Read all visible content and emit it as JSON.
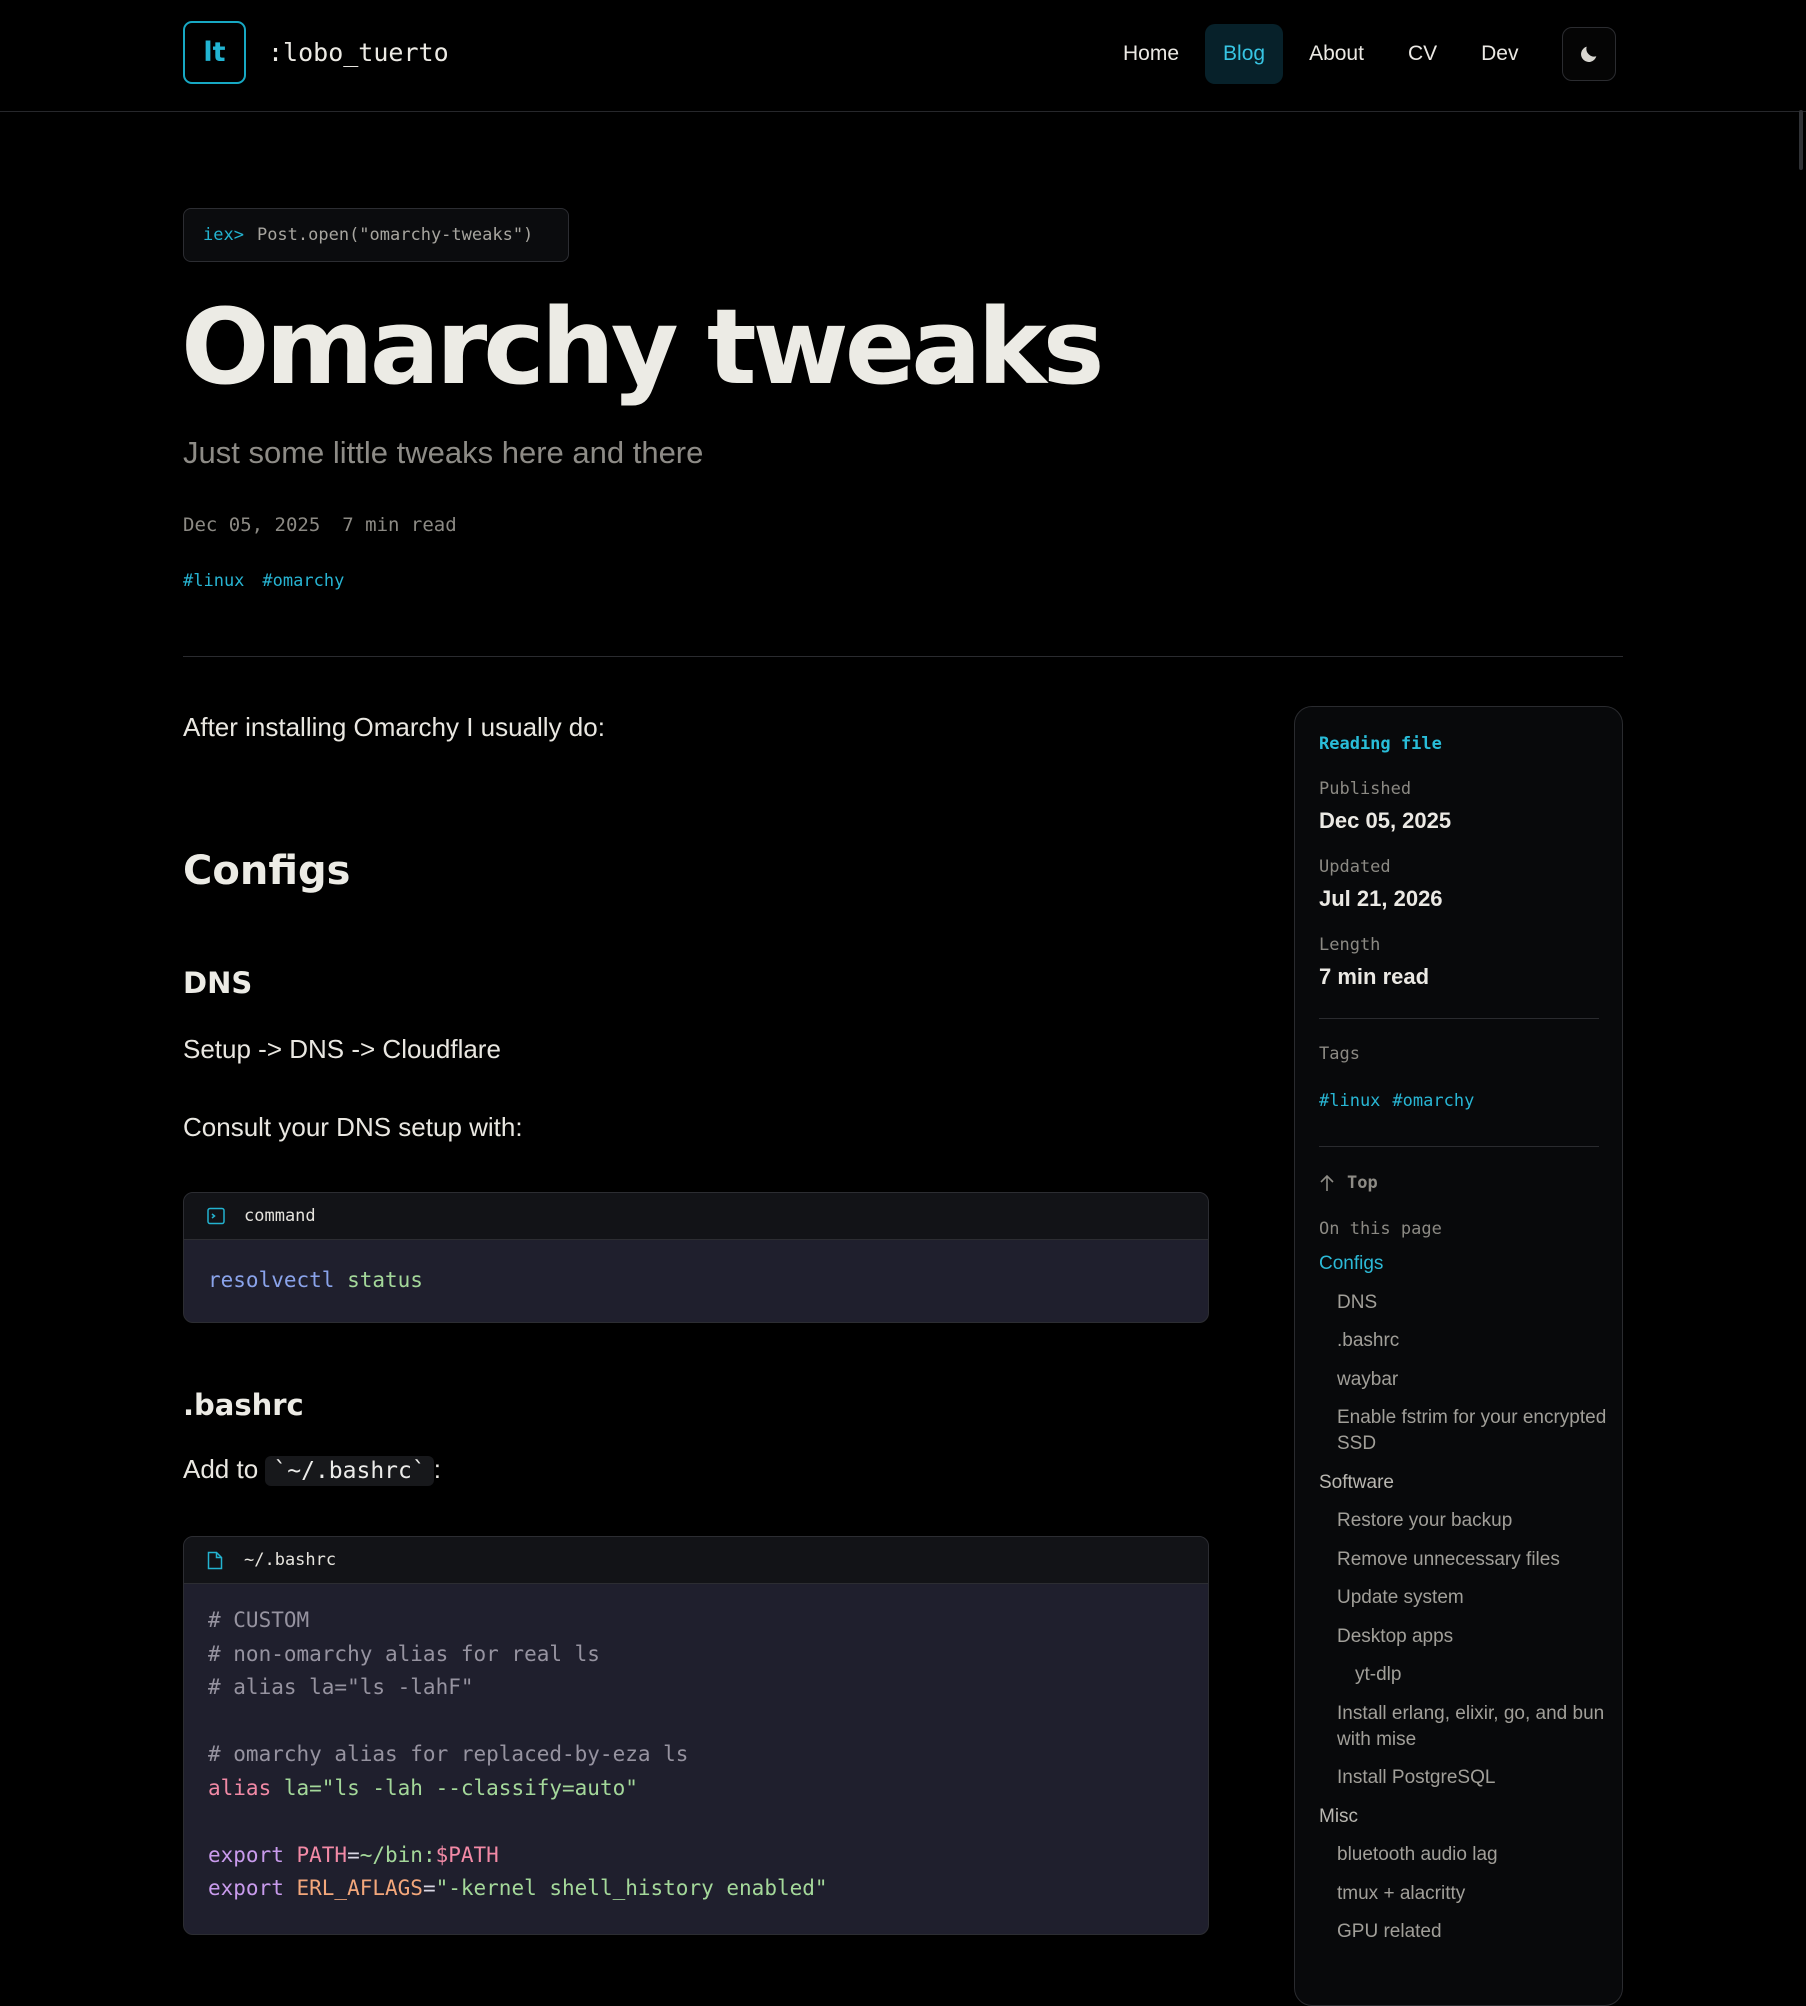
{
  "header": {
    "logo_text": "lt",
    "brand": ":lobo_tuerto",
    "nav": [
      {
        "label": "Home",
        "active": false
      },
      {
        "label": "Blog",
        "active": true
      },
      {
        "label": "About",
        "active": false
      },
      {
        "label": "CV",
        "active": false
      },
      {
        "label": "Dev",
        "active": false
      }
    ],
    "theme_icon": "moon-icon"
  },
  "hero": {
    "prompt_prefix": "iex>",
    "prompt_cmd": "Post.open(\"omarchy-tweaks\")",
    "title": "Omarchy tweaks",
    "subtitle": "Just some little tweaks here and there",
    "date": "Dec 05, 2025",
    "read_time": "7 min read",
    "tags": [
      "#linux",
      "#omarchy"
    ]
  },
  "article": {
    "intro": "After installing Omarchy I usually do:",
    "h2_configs": "Configs",
    "h3_dns": "DNS",
    "dns_setup": "Setup -> DNS -> Cloudflare",
    "dns_consult": "Consult your DNS setup with:",
    "block1": {
      "label": "command",
      "icon": "terminal-icon",
      "cmd_fn": "resolvectl",
      "cmd_arg": " status"
    },
    "h3_bashrc": ".bashrc",
    "bashrc_prefix": "Add to",
    "bashrc_code": "`~/.bashrc`",
    "bashrc_suffix": ":",
    "block2": {
      "label": "~/.bashrc",
      "icon": "file-icon",
      "l1": "# CUSTOM",
      "l2": "# non-omarchy alias for real ls",
      "l3": "# alias la=\"ls -lahF\"",
      "l5": "# omarchy alias for replaced-by-eza ls",
      "l6_kw": "alias",
      "l6_rest": " la=",
      "l6_str": "\"ls -lah --classify=auto\"",
      "l8_kw": "export",
      "l8_var": " PATH",
      "l8_eq": "=",
      "l8_val": "~/bin:",
      "l8_var2": "$PATH",
      "l9_kw": "export",
      "l9_var": " ERL_AFLAGS",
      "l9_eq": "=",
      "l9_str": "\"-kernel shell_history enabled\""
    }
  },
  "sidebar": {
    "heading": "Reading file",
    "published_label": "Published",
    "published": "Dec 05, 2025",
    "updated_label": "Updated",
    "updated": "Jul 21, 2026",
    "length_label": "Length",
    "length": "7 min read",
    "tags_label": "Tags",
    "tags": [
      "#linux",
      "#omarchy"
    ],
    "top_label": "Top",
    "toc_label": "On this page",
    "toc": [
      {
        "label": "Configs",
        "level": 1,
        "active": true
      },
      {
        "label": "DNS",
        "level": 2
      },
      {
        "label": ".bashrc",
        "level": 2
      },
      {
        "label": "waybar",
        "level": 2
      },
      {
        "label": "Enable fstrim for your encrypted SSD",
        "level": 2
      },
      {
        "label": "Software",
        "level": 1
      },
      {
        "label": "Restore your backup",
        "level": 2
      },
      {
        "label": "Remove unnecessary files",
        "level": 2
      },
      {
        "label": "Update system",
        "level": 2
      },
      {
        "label": "Desktop apps",
        "level": 2
      },
      {
        "label": "yt-dlp",
        "level": 3
      },
      {
        "label": "Install erlang, elixir, go, and bun with mise",
        "level": 2
      },
      {
        "label": "Install PostgreSQL",
        "level": 2
      },
      {
        "label": "Misc",
        "level": 1
      },
      {
        "label": "bluetooth audio lag",
        "level": 2
      },
      {
        "label": "tmux + alacritty",
        "level": 2
      },
      {
        "label": "GPU related",
        "level": 2
      }
    ]
  },
  "colors": {
    "accent": "#22b5d3",
    "background": "#000000",
    "code_bg": "#1f1f2d"
  }
}
